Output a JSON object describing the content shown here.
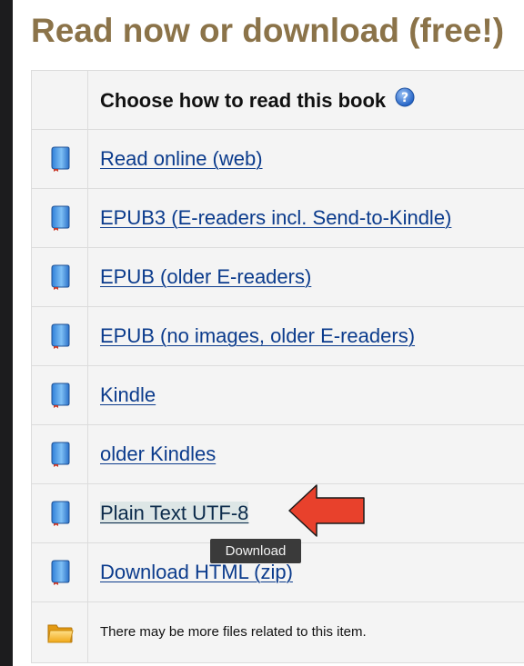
{
  "page": {
    "title": "Read now or download (free!)"
  },
  "table": {
    "header_label": "Choose how to read this book",
    "help_icon": "help-icon",
    "formats": [
      {
        "label": "Read online (web)",
        "icon": "book-icon"
      },
      {
        "label": "EPUB3 (E-readers incl. Send-to-Kindle)",
        "icon": "book-icon"
      },
      {
        "label": "EPUB (older E-readers)",
        "icon": "book-icon"
      },
      {
        "label": "EPUB (no images, older E-readers)",
        "icon": "book-icon"
      },
      {
        "label": "Kindle",
        "icon": "book-icon"
      },
      {
        "label": "older Kindles",
        "icon": "book-icon"
      },
      {
        "label": "Plain Text UTF-8",
        "icon": "book-icon",
        "hovered": true
      },
      {
        "label": "Download HTML (zip)",
        "icon": "book-icon"
      }
    ],
    "note": {
      "text": "There may be more files related to this item.",
      "icon": "folder-icon"
    }
  },
  "tooltip": {
    "text": "Download"
  },
  "annotation": {
    "icon": "red-arrow-icon",
    "color": "#e8412c"
  }
}
